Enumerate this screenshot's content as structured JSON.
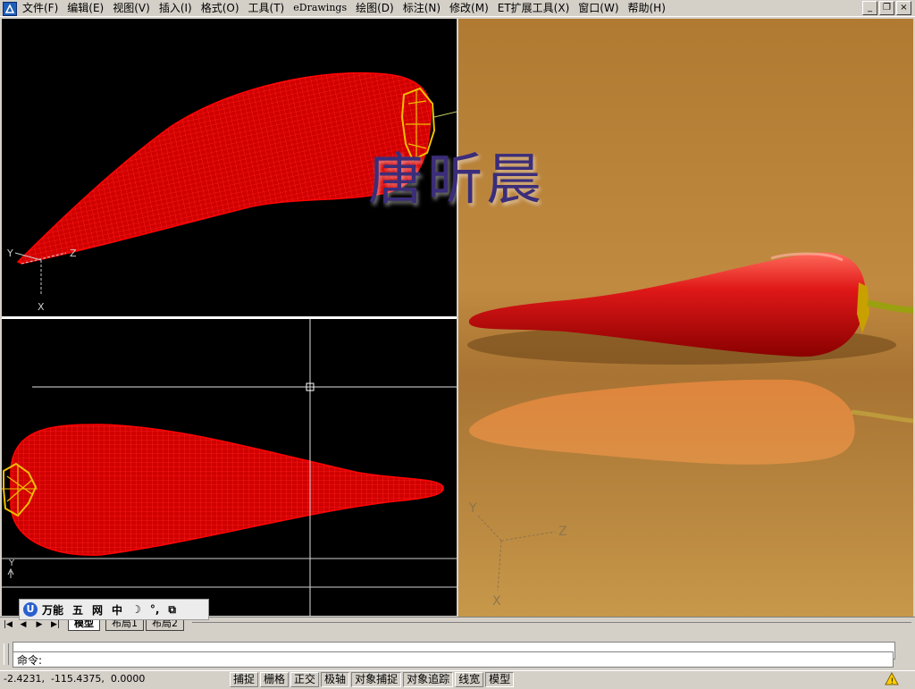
{
  "menu": {
    "items": [
      {
        "label": "文件(F)"
      },
      {
        "label": "编辑(E)"
      },
      {
        "label": "视图(V)"
      },
      {
        "label": "插入(I)"
      },
      {
        "label": "格式(O)"
      },
      {
        "label": "工具(T)"
      },
      {
        "label": "eDrawings"
      },
      {
        "label": "绘图(D)"
      },
      {
        "label": "标注(N)"
      },
      {
        "label": "修改(M)"
      },
      {
        "label": "ET扩展工具(X)"
      },
      {
        "label": "窗口(W)"
      },
      {
        "label": "帮助(H)"
      }
    ]
  },
  "window_controls": {
    "minimize": "_",
    "restore": "❐",
    "close": "×"
  },
  "viewports": {
    "top": {
      "axes": {
        "y": "Y",
        "z": "Z",
        "x": "X"
      }
    },
    "bottom": {
      "axes": {
        "y": "Y"
      }
    },
    "render": {
      "axes": {
        "y": "Y",
        "z": "Z",
        "x": "X"
      }
    }
  },
  "watermark": "唐昕晨",
  "ime": {
    "logo": "U",
    "name": "万能",
    "items": [
      "五",
      "网",
      "中",
      "☽",
      "°,",
      "⧉"
    ]
  },
  "tabs": {
    "nav": [
      "|◀",
      "◀",
      "▶",
      "▶|"
    ],
    "layouts": [
      {
        "label": "模型",
        "active": true
      },
      {
        "label": "布局1",
        "active": false
      },
      {
        "label": "布局2",
        "active": false
      }
    ]
  },
  "command": {
    "prompt": "命令:"
  },
  "status": {
    "coords": "-2.4231,  -115.4375,  0.0000",
    "toggles": [
      {
        "label": "捕捉",
        "on": false
      },
      {
        "label": "栅格",
        "on": false
      },
      {
        "label": "正交",
        "on": false
      },
      {
        "label": "极轴",
        "on": true
      },
      {
        "label": "对象捕捉",
        "on": true
      },
      {
        "label": "对象追踪",
        "on": true
      },
      {
        "label": "线宽",
        "on": false
      },
      {
        "label": "模型",
        "on": true
      }
    ]
  },
  "colors": {
    "pepper_red": "#ff0000",
    "stem_yellow": "#e8c400",
    "render_bg": "#b07a32",
    "viewport_bg": "#000000"
  }
}
